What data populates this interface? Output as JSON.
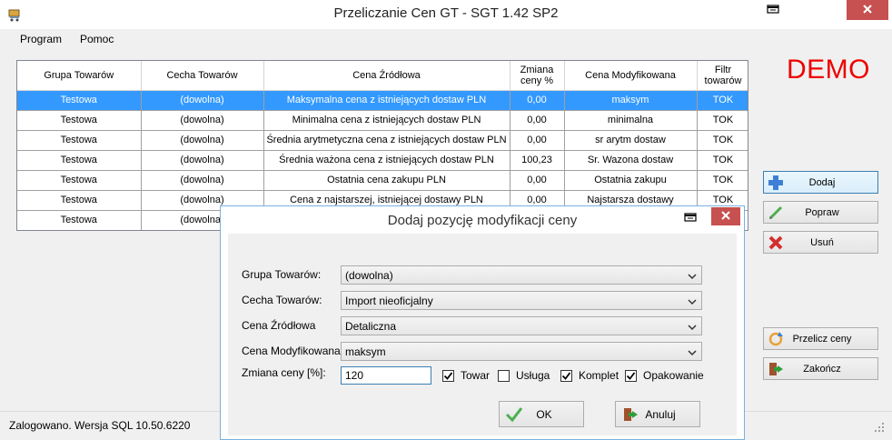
{
  "window": {
    "title": "Przeliczanie Cen GT - SGT 1.42 SP2"
  },
  "menu": [
    {
      "label": "Program"
    },
    {
      "label": "Pomoc"
    }
  ],
  "demo_label": "DEMO",
  "grid": {
    "headers": [
      "Grupa Towarów",
      "Cecha Towarów",
      "Cena Źródłowa",
      "Zmiana ceny %",
      "Cena Modyfikowana",
      "Filtr towarów"
    ],
    "rows": [
      [
        "Testowa",
        "(dowolna)",
        "Maksymalna cena z istniejących dostaw PLN",
        "0,00",
        "maksym",
        "TOK"
      ],
      [
        "Testowa",
        "(dowolna)",
        "Minimalna cena z istniejących dostaw PLN",
        "0,00",
        "minimalna",
        "TOK"
      ],
      [
        "Testowa",
        "(dowolna)",
        "Średnia arytmetyczna cena z istniejących dostaw PLN",
        "0,00",
        "sr arytm dostaw",
        "TOK"
      ],
      [
        "Testowa",
        "(dowolna)",
        "Średnia ważona cena z istniejących dostaw PLN",
        "100,23",
        "Sr. Wazona dostaw",
        "TOK"
      ],
      [
        "Testowa",
        "(dowolna)",
        "Ostatnia cena zakupu PLN",
        "0,00",
        "Ostatnia zakupu",
        "TOK"
      ],
      [
        "Testowa",
        "(dowolna)",
        "Cena z najstarszej, istniejącej dostawy PLN",
        "0,00",
        "Najstarsza dostawy",
        "TOK"
      ],
      [
        "Testowa",
        "(dowolna)",
        "",
        "",
        "",
        ""
      ]
    ],
    "selected_row": 0
  },
  "side_buttons": {
    "add": "Dodaj",
    "edit": "Popraw",
    "delete": "Usuń",
    "recalc": "Przelicz ceny",
    "exit": "Zakończ"
  },
  "status": {
    "text": "Zalogowano. Wersja SQL 10.50.6220"
  },
  "dialog": {
    "title": "Dodaj pozycję modyfikacji ceny",
    "fields": {
      "group_label": "Grupa Towarów:",
      "group_value": "(dowolna)",
      "feature_label": "Cecha Towarów:",
      "feature_value": "Import nieoficjalny",
      "source_label": "Cena Źródłowa",
      "source_value": "Detaliczna",
      "modified_label": "Cena Modyfikowana:",
      "modified_value": "maksym",
      "change_label": "Zmiana ceny [%]:",
      "change_value": "120"
    },
    "checkboxes": [
      {
        "label": "Towar",
        "checked": true
      },
      {
        "label": "Usługa",
        "checked": false
      },
      {
        "label": "Komplet",
        "checked": true
      },
      {
        "label": "Opakowanie",
        "checked": true
      }
    ],
    "ok_label": "OK",
    "cancel_label": "Anuluj"
  },
  "colors": {
    "selection": "#3399ff",
    "close_button": "#c75050",
    "demo": "#ee0000",
    "dialog_border": "#7ab0e0"
  }
}
